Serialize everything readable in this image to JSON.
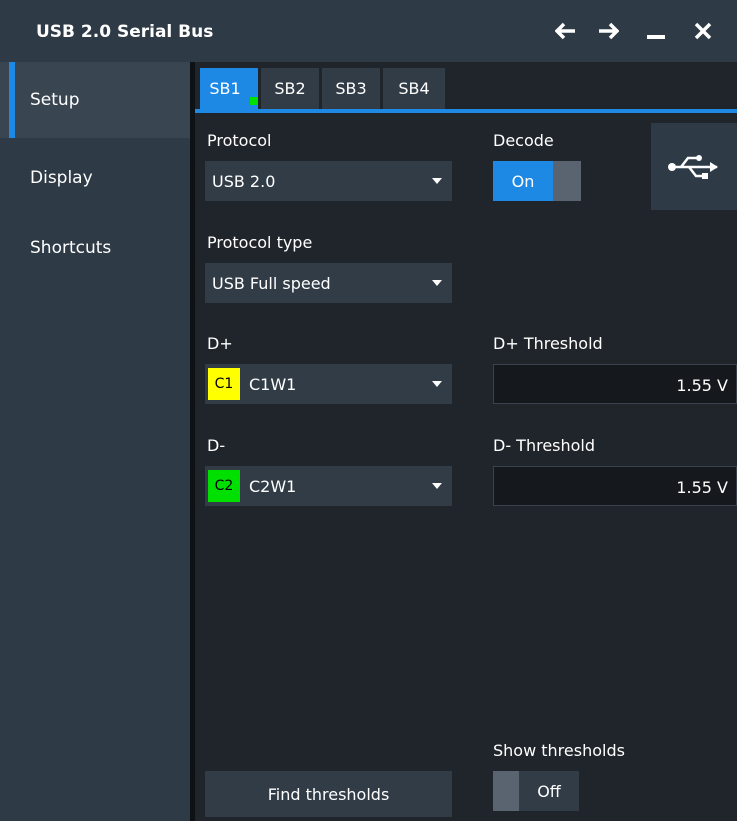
{
  "window": {
    "title": "USB 2.0 Serial Bus",
    "controls": [
      "back",
      "forward",
      "minimize",
      "close"
    ]
  },
  "sidebar": {
    "items": [
      {
        "label": "Setup",
        "active": true
      },
      {
        "label": "Display",
        "active": false
      },
      {
        "label": "Shortcuts",
        "active": false
      }
    ]
  },
  "tabs": [
    {
      "label": "SB1",
      "active": true
    },
    {
      "label": "SB2",
      "active": false
    },
    {
      "label": "SB3",
      "active": false
    },
    {
      "label": "SB4",
      "active": false
    }
  ],
  "protocol": {
    "label": "Protocol",
    "value": "USB 2.0"
  },
  "decode": {
    "label": "Decode",
    "state": "On"
  },
  "protocol_type": {
    "label": "Protocol type",
    "value": "USB Full speed"
  },
  "dplus": {
    "label": "D+",
    "channel_badge": "C1",
    "channel_color": "#ffff00",
    "value": "C1W1"
  },
  "dplus_threshold": {
    "label": "D+ Threshold",
    "value": "1.55 V"
  },
  "dminus": {
    "label": "D-",
    "channel_badge": "C2",
    "channel_color": "#00e000",
    "value": "C2W1"
  },
  "dminus_threshold": {
    "label": "D- Threshold",
    "value": "1.55 V"
  },
  "show_thresholds": {
    "label": "Show thresholds",
    "state": "Off"
  },
  "find_thresholds": {
    "label": "Find thresholds"
  },
  "colors": {
    "accent": "#1e88e5",
    "panel": "#20252b",
    "sidebar": "#2e3a46"
  }
}
